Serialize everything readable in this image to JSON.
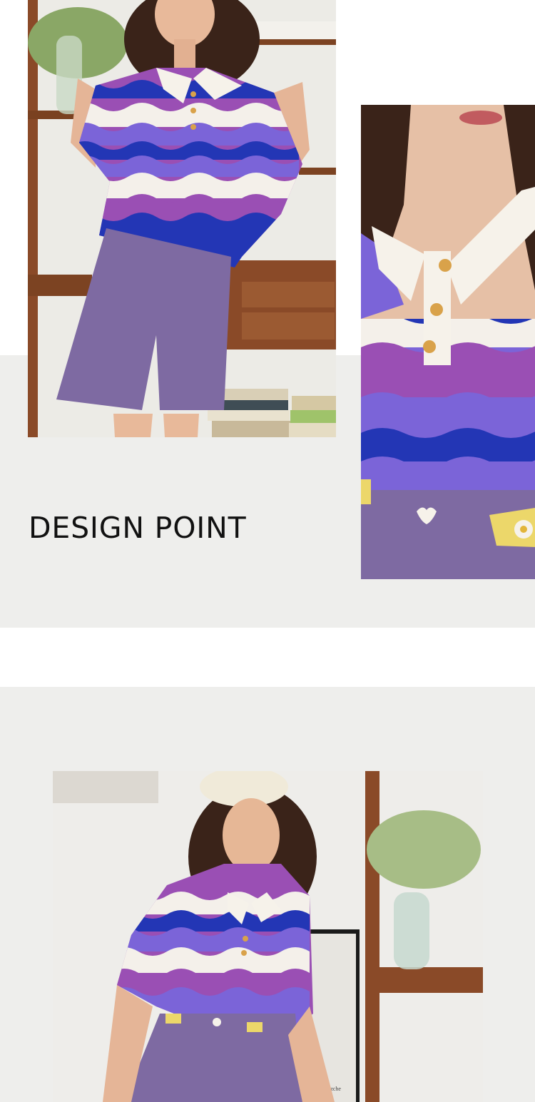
{
  "heading": "DESIGN POINT",
  "colors": {
    "page_background": "#ffffff",
    "band_grey": "#eeeeec",
    "heading_text": "#111111",
    "stripe_purple": "#9a4fb4",
    "stripe_lavender": "#7b64d8",
    "stripe_blue": "#2336b5",
    "stripe_white": "#f4f0ea",
    "shorts_purple": "#7e6aa2",
    "wood": "#8a4a28",
    "belt_yellow": "#ecd76a"
  },
  "images": [
    {
      "name": "model-full-body-photo",
      "description_icon": "photo-placeholder-icon"
    },
    {
      "name": "collar-detail-photo",
      "description_icon": "photo-placeholder-icon"
    },
    {
      "name": "model-smiling-photo",
      "description_icon": "photo-placeholder-icon"
    }
  ],
  "poster_text": "Jurida Nietzche"
}
